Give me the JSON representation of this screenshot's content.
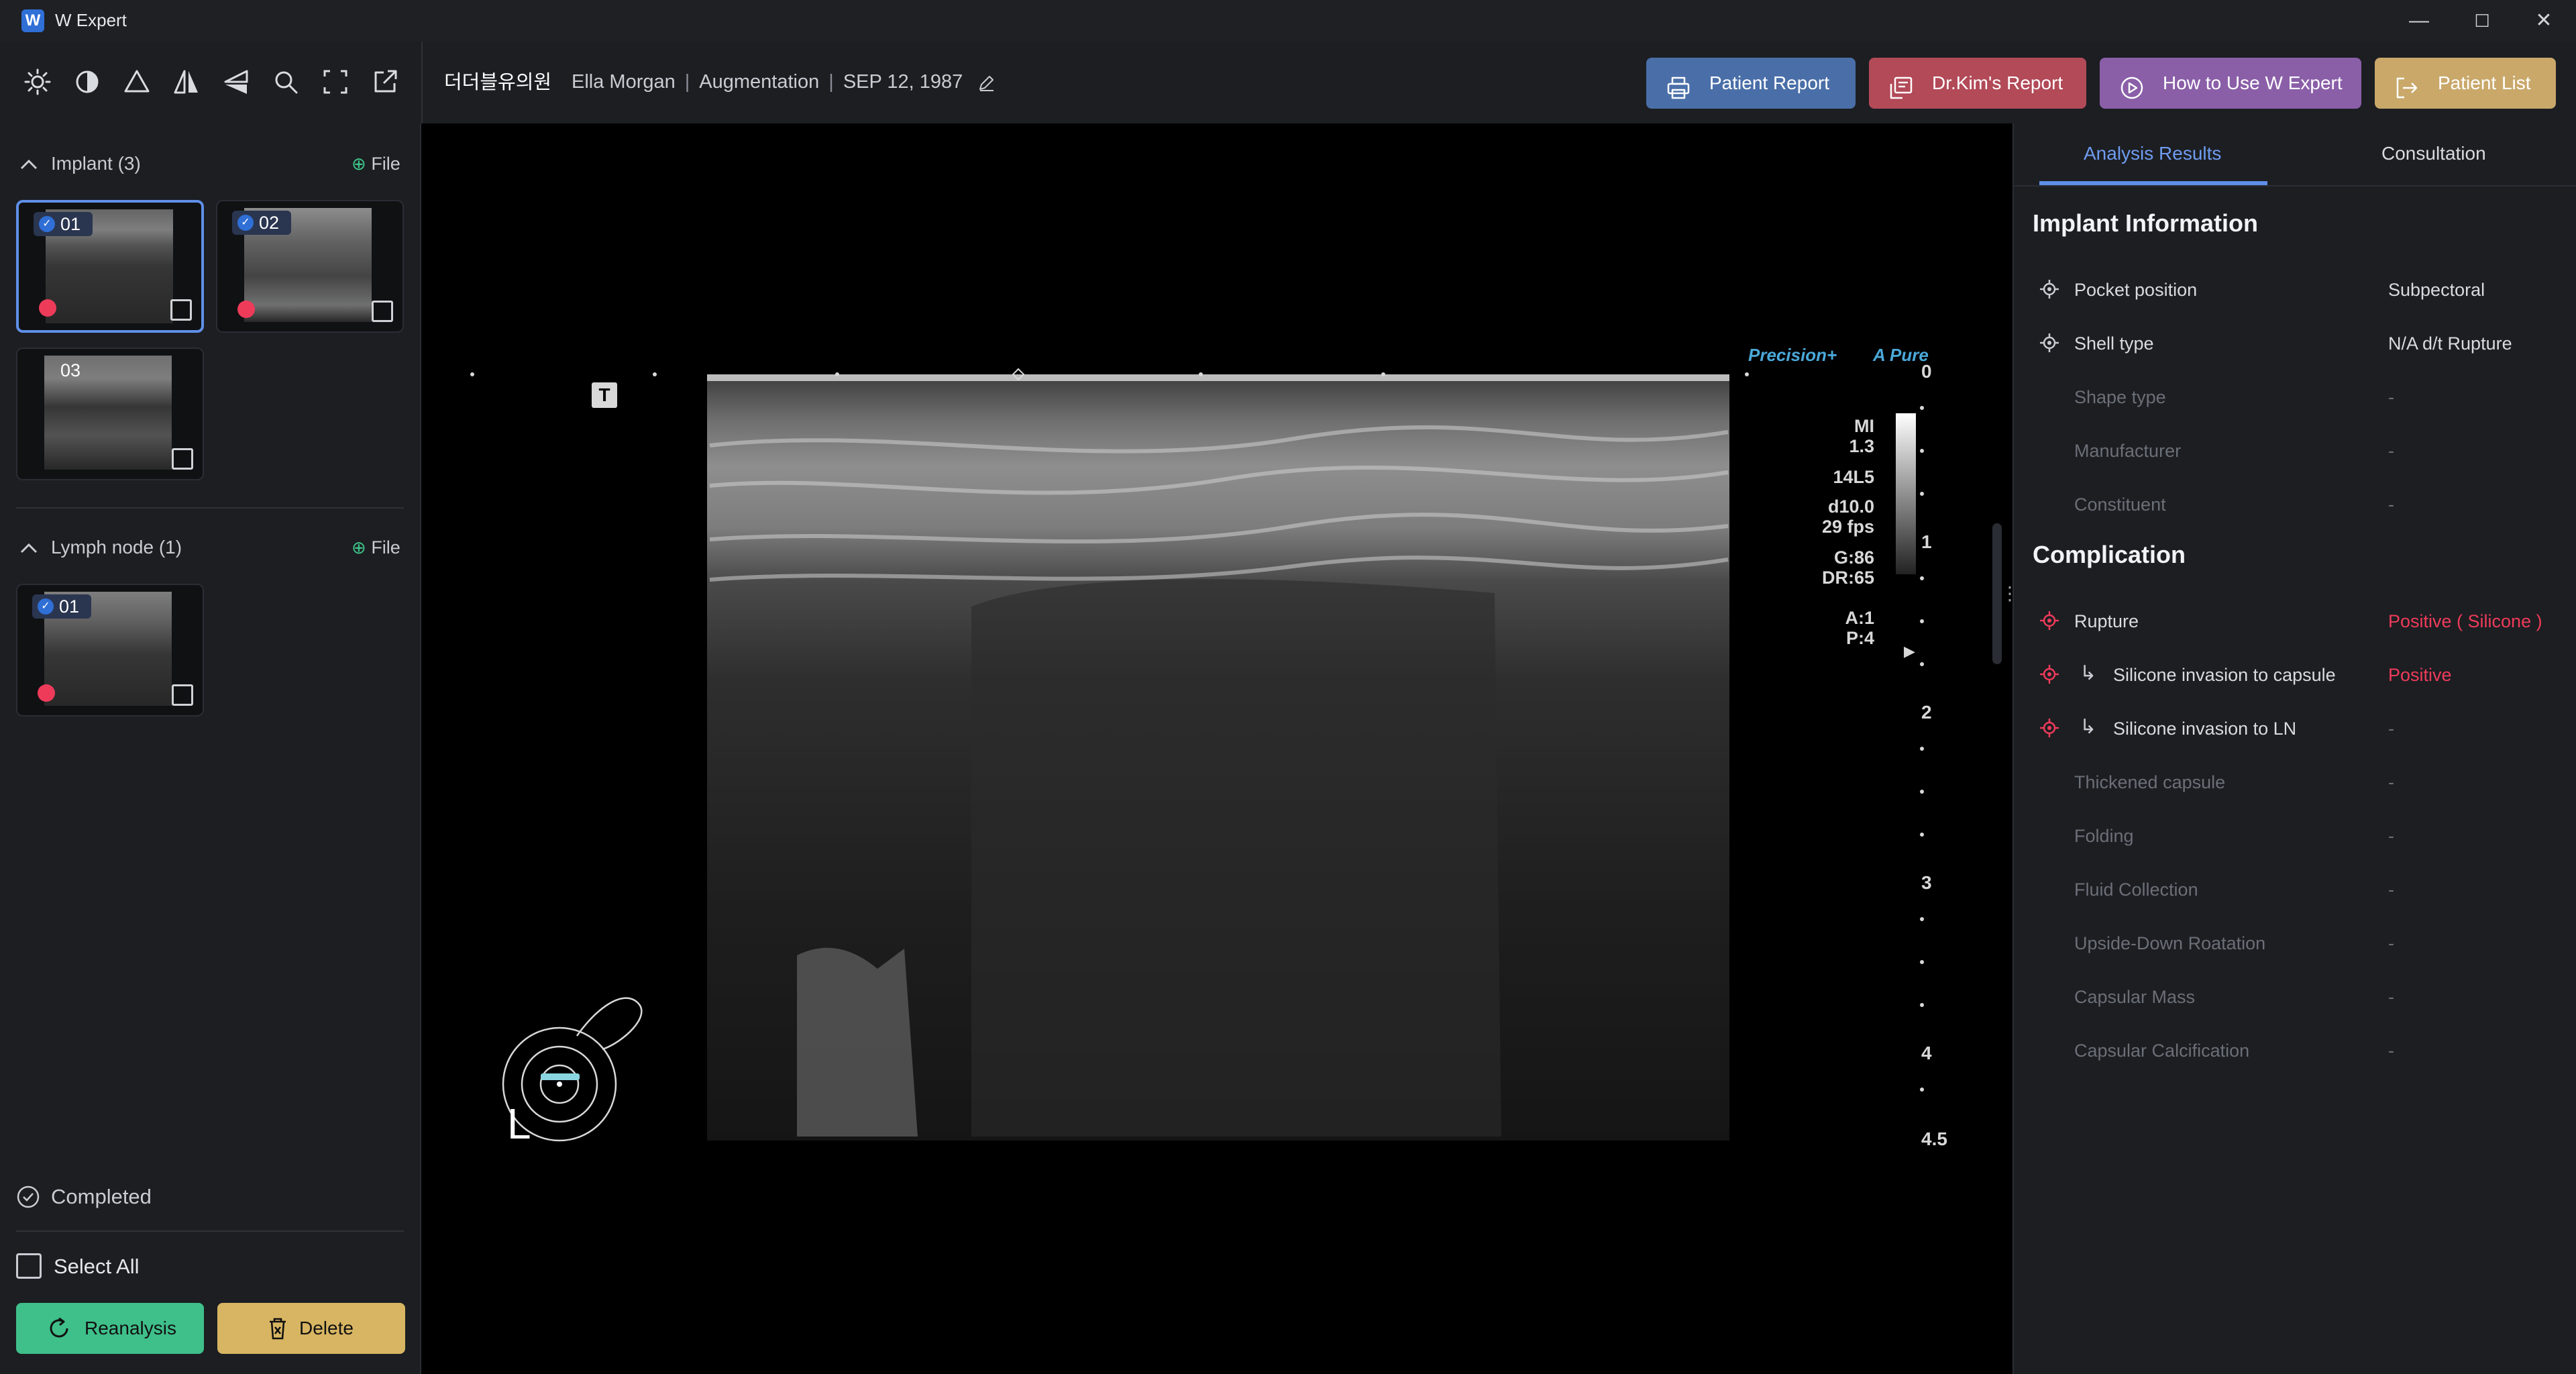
{
  "app": {
    "title": "W Expert",
    "logo_letter": "W"
  },
  "window_controls": {
    "minimize": "—",
    "maximize": "☐",
    "close": "✕"
  },
  "toolbar": {
    "tools": [
      "brightness-icon",
      "contrast-icon",
      "triangle-icon",
      "flip-horizontal-icon",
      "flip-vertical-icon",
      "zoom-icon",
      "fullscreen-icon",
      "export-icon"
    ]
  },
  "header": {
    "hospital": "더더블유의원",
    "patient_name": "Ella Morgan",
    "procedure": "Augmentation",
    "dob": "SEP 12, 1987",
    "buttons": [
      {
        "label": "Patient Report",
        "color": "#4a6fa8"
      },
      {
        "label": "Dr.Kim's Report",
        "color": "#b24a58"
      },
      {
        "label": "How to Use W Expert",
        "color": "#8a5fa8"
      },
      {
        "label": "Patient List",
        "color": "#c9a86a"
      }
    ]
  },
  "left": {
    "implant": {
      "label": "Implant",
      "count": "(3)",
      "file": "File",
      "thumbs": [
        {
          "num": "01",
          "checked": true,
          "flag": true
        },
        {
          "num": "02",
          "checked": true,
          "flag": true
        },
        {
          "num": "03",
          "checked": false,
          "flag": false
        }
      ]
    },
    "lymph": {
      "label": "Lymph node",
      "count": "(1)",
      "file": "File",
      "thumbs": [
        {
          "num": "01",
          "checked": true,
          "flag": true
        }
      ]
    },
    "completed": "Completed",
    "select_all": "Select All",
    "reanalysis": "Reanalysis",
    "delete": "Delete"
  },
  "viewer": {
    "logo1": "Precision+",
    "logo2": "Pure",
    "params": [
      "MI",
      "1.3",
      "14L5",
      "d10.0",
      "29 fps",
      "G:86",
      "DR:65",
      "A:1",
      "P:4"
    ],
    "depth_scale": [
      "0",
      "1",
      "2",
      "3",
      "4",
      "4.5"
    ],
    "side_marker": "L",
    "t_marker": "T"
  },
  "right": {
    "tabs": [
      "Analysis Results",
      "Consultation"
    ],
    "implant_title": "Implant Information",
    "implant_rows": [
      {
        "label": "Pocket position",
        "value": "Subpectoral",
        "active": true
      },
      {
        "label": "Shell type",
        "value": "N/A d/t Rupture",
        "active": true
      },
      {
        "label": "Shape type",
        "value": "-",
        "active": false
      },
      {
        "label": "Manufacturer",
        "value": "-",
        "active": false
      },
      {
        "label": "Constituent",
        "value": "-",
        "active": false
      }
    ],
    "complication_title": "Complication",
    "complication_rows": [
      {
        "label": "Rupture",
        "value": "Positive ( Silicone )",
        "active": true,
        "sub": false
      },
      {
        "label": "Silicone invasion to capsule",
        "value": "Positive",
        "active": true,
        "sub": true
      },
      {
        "label": "Silicone invasion to LN",
        "value": "-",
        "active": true,
        "sub": true
      },
      {
        "label": "Thickened capsule",
        "value": "-",
        "active": false,
        "sub": false
      },
      {
        "label": "Folding",
        "value": "-",
        "active": false,
        "sub": false
      },
      {
        "label": "Fluid Collection",
        "value": "-",
        "active": false,
        "sub": false
      },
      {
        "label": "Upside-Down Roatation",
        "value": "-",
        "active": false,
        "sub": false
      },
      {
        "label": "Capsular Mass",
        "value": "-",
        "active": false,
        "sub": false
      },
      {
        "label": "Capsular Calcification",
        "value": "-",
        "active": false,
        "sub": false
      }
    ],
    "colors": {
      "accent": "#5f8fe8",
      "positive": "#ef3b5a",
      "muted": "#6b6f77"
    }
  }
}
